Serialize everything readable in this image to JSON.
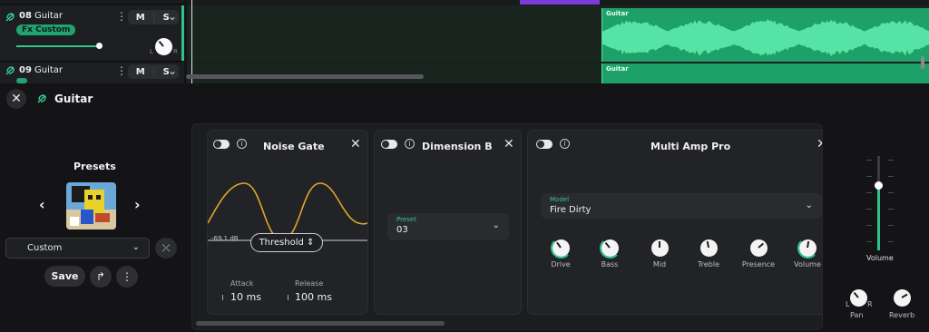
{
  "tracks": [
    {
      "number": "08",
      "name": "Guitar",
      "mute": "M",
      "solo": "S",
      "fx_badge": "Fx Custom",
      "pan_left": "L",
      "pan_right": "R",
      "clip_label": "Guitar"
    },
    {
      "number": "09",
      "name": "Guitar",
      "mute": "M",
      "solo": "S",
      "clip_label": "Guitar"
    }
  ],
  "panel": {
    "title": "Guitar",
    "close_icon": "close-icon",
    "presets": {
      "title": "Presets",
      "prev": "‹",
      "next": "›",
      "selected": "Custom",
      "save_label": "Save"
    },
    "effects": {
      "noise_gate": {
        "title": "Noise Gate",
        "db_readout": "-69.1 dB",
        "threshold_label": "Threshold",
        "attack_label": "Attack",
        "attack_value": "10 ms",
        "release_label": "Release",
        "release_value": "100 ms"
      },
      "dimension": {
        "title": "Dimension B",
        "preset_label": "Preset",
        "preset_value": "03"
      },
      "amp": {
        "title": "Multi Amp Pro",
        "model_label": "Model",
        "model_value": "Fire Dirty",
        "knobs": [
          {
            "label": "Drive"
          },
          {
            "label": "Bass"
          },
          {
            "label": "Mid"
          },
          {
            "label": "Treble"
          },
          {
            "label": "Presence"
          },
          {
            "label": "Volume"
          }
        ]
      }
    },
    "mixer": {
      "volume_label": "Volume",
      "pan_label": "Pan",
      "pan_left": "L",
      "pan_right": "R",
      "reverb_label": "Reverb"
    }
  },
  "colors": {
    "accent": "#2fc28a",
    "clip": "#1ea168",
    "purple_clip": "#7a3bd6",
    "waveform": "#e0a52a"
  }
}
